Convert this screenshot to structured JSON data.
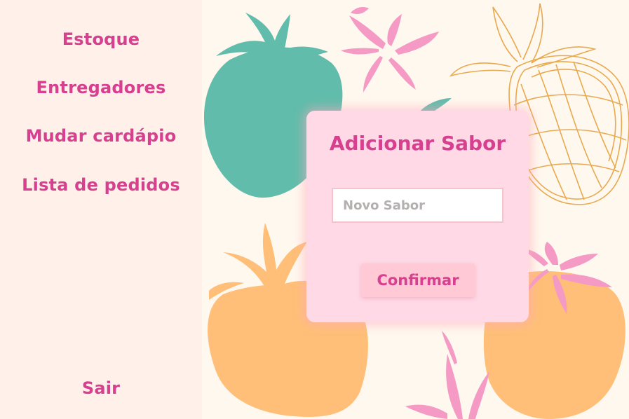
{
  "sidebar": {
    "items": [
      {
        "label": "Estoque"
      },
      {
        "label": "Entregadores"
      },
      {
        "label": "Mudar cardápio"
      },
      {
        "label": "Lista de pedidos"
      }
    ],
    "logout_label": "Sair"
  },
  "modal": {
    "title": "Adicionar Sabor",
    "input_placeholder": "Novo Sabor",
    "input_value": "",
    "confirm_label": "Confirmar"
  },
  "colors": {
    "accent": "#d6408f",
    "sidebar_bg": "#fff0ea",
    "page_bg": "#fff8ee",
    "modal_bg": "#ffd9e6",
    "button_bg": "#ffc9d6",
    "teal_strawberry": "#62bcab",
    "orange_strawberry": "#ffbf78",
    "pink_flower": "#f49ac4",
    "outline_strawberry": "#e9a94e"
  }
}
